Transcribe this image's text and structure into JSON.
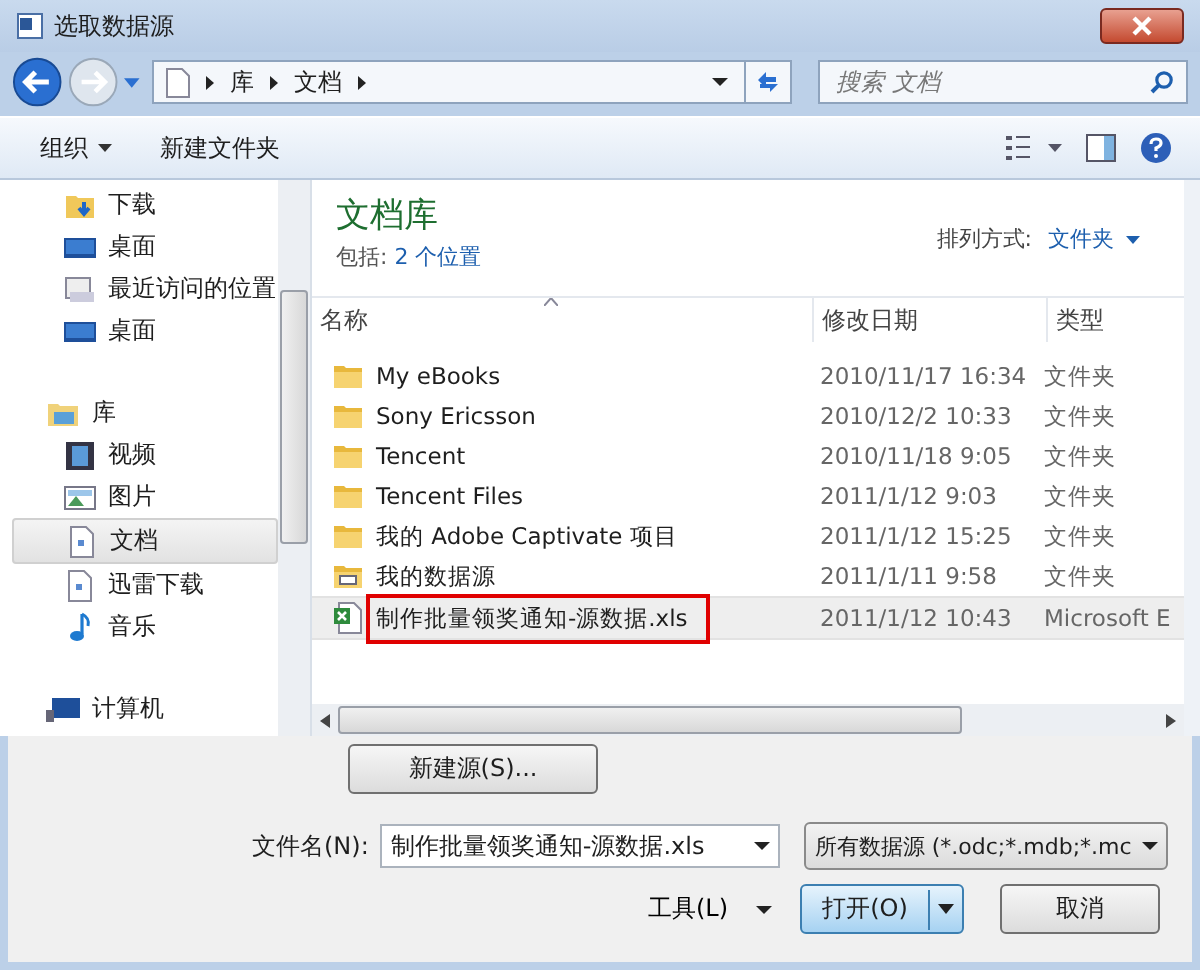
{
  "window": {
    "title": "选取数据源"
  },
  "address": {
    "crumbs": [
      "库",
      "文档"
    ],
    "search_placeholder": "搜索 文档"
  },
  "toolbar": {
    "organize": "组织",
    "new_folder": "新建文件夹"
  },
  "nav": {
    "favorites": [
      {
        "label": "下载",
        "kind": "download",
        "selected": false
      },
      {
        "label": "桌面",
        "kind": "desktop",
        "selected": false
      },
      {
        "label": "最近访问的位置",
        "kind": "recent",
        "selected": false
      },
      {
        "label": "桌面",
        "kind": "desktop",
        "selected": false
      }
    ],
    "library": {
      "label": "库",
      "children": [
        {
          "label": "视频",
          "kind": "video",
          "selected": false
        },
        {
          "label": "图片",
          "kind": "picture",
          "selected": false
        },
        {
          "label": "文档",
          "kind": "document",
          "selected": true
        },
        {
          "label": "迅雷下载",
          "kind": "document",
          "selected": false
        },
        {
          "label": "音乐",
          "kind": "music",
          "selected": false
        }
      ]
    },
    "computer": {
      "label": "计算机"
    }
  },
  "library_header": {
    "title": "文档库",
    "includes_label": "包括:",
    "includes_link": "2 个位置",
    "arrange_label": "排列方式:",
    "arrange_value": "文件夹"
  },
  "table": {
    "columns": [
      "名称",
      "修改日期",
      "类型"
    ],
    "rows": [
      {
        "name": "My eBooks",
        "date": "2010/11/17 16:34",
        "type": "文件夹",
        "kind": "folder",
        "selected": false,
        "marked": false
      },
      {
        "name": "Sony Ericsson",
        "date": "2010/12/2 10:33",
        "type": "文件夹",
        "kind": "folder",
        "selected": false,
        "marked": false
      },
      {
        "name": "Tencent",
        "date": "2010/11/18 9:05",
        "type": "文件夹",
        "kind": "folder",
        "selected": false,
        "marked": false
      },
      {
        "name": "Tencent Files",
        "date": "2011/1/12 9:03",
        "type": "文件夹",
        "kind": "folder",
        "selected": false,
        "marked": false
      },
      {
        "name": "我的 Adobe Captivate 项目",
        "date": "2011/1/12 15:25",
        "type": "文件夹",
        "kind": "folder",
        "selected": false,
        "marked": false
      },
      {
        "name": "我的数据源",
        "date": "2011/1/11 9:58",
        "type": "文件夹",
        "kind": "datasource",
        "selected": false,
        "marked": false
      },
      {
        "name": "制作批量领奖通知-源数据.xls",
        "date": "2011/1/12 10:43",
        "type": "Microsoft E",
        "kind": "excel",
        "selected": true,
        "marked": true
      }
    ]
  },
  "new_source_button": "新建源(S)...",
  "filename": {
    "label": "文件名(N):",
    "value": "制作批量领奖通知-源数据.xls"
  },
  "filter": {
    "value": "所有数据源 (*.odc;*.mdb;*.mc"
  },
  "tools": "工具(L)",
  "open_button": "打开(O)",
  "cancel_button": "取消"
}
